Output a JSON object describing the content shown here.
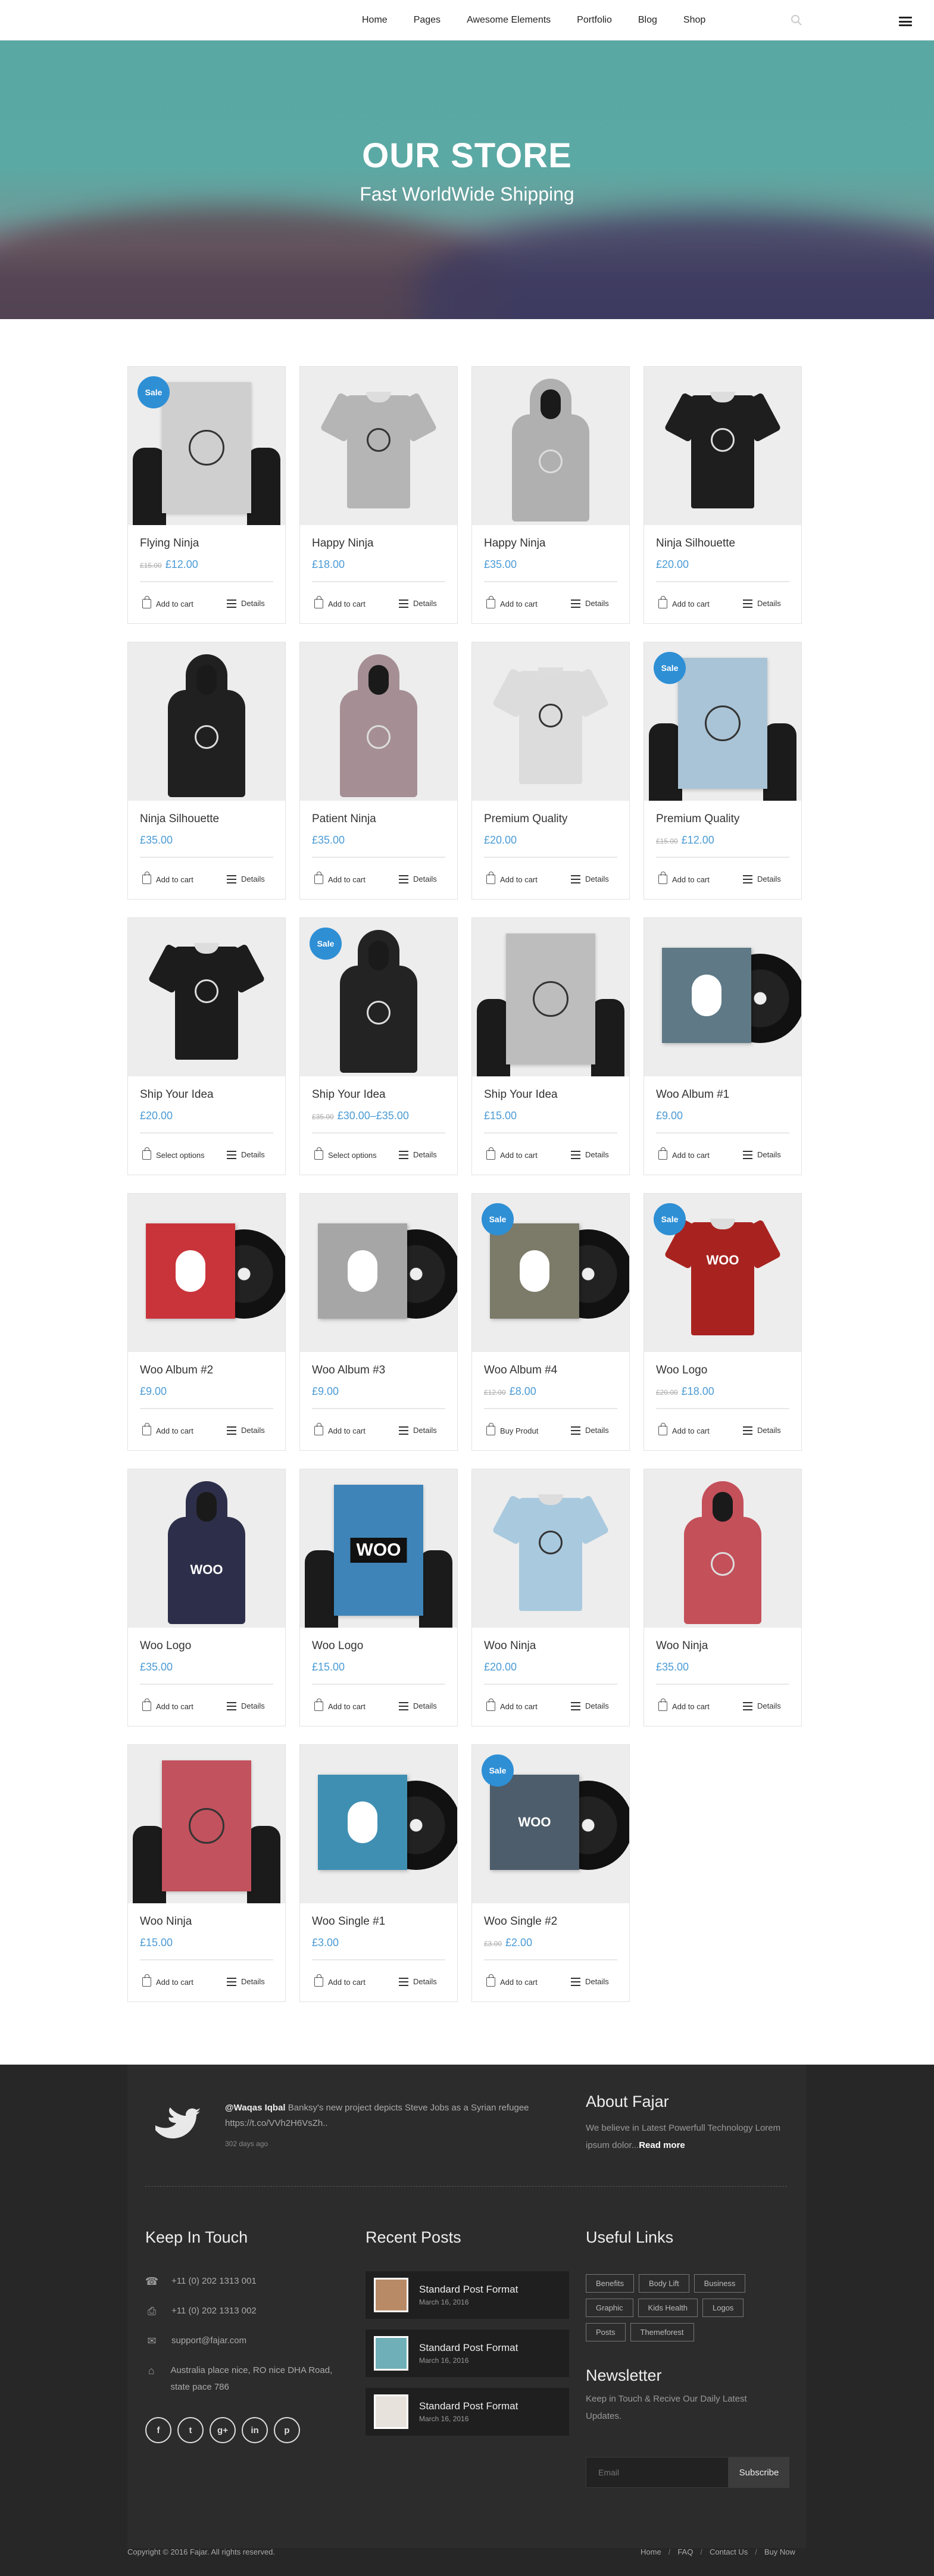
{
  "nav": {
    "items": [
      "Home",
      "Pages",
      "Awesome Elements",
      "Portfolio",
      "Blog",
      "Shop"
    ]
  },
  "hero": {
    "title": "OUR STORE",
    "subtitle": "Fast WorldWide Shipping"
  },
  "products": [
    {
      "title": "Flying Ninja",
      "old_price": "£15.00",
      "price": "£12.00",
      "sale": true,
      "cart_label": "Add to cart",
      "details_label": "Details",
      "art": "poster",
      "color": "#cfcfcf"
    },
    {
      "title": "Happy Ninja",
      "old_price": "",
      "price": "£18.00",
      "sale": false,
      "cart_label": "Add to cart",
      "details_label": "Details",
      "art": "shirt",
      "color": "#b5b5b5"
    },
    {
      "title": "Happy Ninja",
      "old_price": "",
      "price": "£35.00",
      "sale": false,
      "cart_label": "Add to cart",
      "details_label": "Details",
      "art": "hoodie",
      "color": "#b0b0b0"
    },
    {
      "title": "Ninja Silhouette",
      "old_price": "",
      "price": "£20.00",
      "sale": false,
      "cart_label": "Add to cart",
      "details_label": "Details",
      "art": "shirt",
      "color": "#1e1e1e"
    },
    {
      "title": "Ninja Silhouette",
      "old_price": "",
      "price": "£35.00",
      "sale": false,
      "cart_label": "Add to cart",
      "details_label": "Details",
      "art": "hoodie",
      "color": "#202020"
    },
    {
      "title": "Patient Ninja",
      "old_price": "",
      "price": "£35.00",
      "sale": false,
      "cart_label": "Add to cart",
      "details_label": "Details",
      "art": "hoodie",
      "color": "#a58f95"
    },
    {
      "title": "Premium Quality",
      "old_price": "",
      "price": "£20.00",
      "sale": false,
      "cart_label": "Add to cart",
      "details_label": "Details",
      "art": "shirt",
      "color": "#dcdcdc"
    },
    {
      "title": "Premium Quality",
      "old_price": "£15.00",
      "price": "£12.00",
      "sale": true,
      "cart_label": "Add to cart",
      "details_label": "Details",
      "art": "poster",
      "color": "#a9c4d6"
    },
    {
      "title": "Ship Your Idea",
      "old_price": "",
      "price": "£20.00",
      "sale": false,
      "cart_label": "Select options",
      "details_label": "Details",
      "art": "shirt",
      "color": "#1c1c1c"
    },
    {
      "title": "Ship Your Idea",
      "old_price": "£35.00",
      "price": "£30.00–£35.00",
      "sale": true,
      "cart_label": "Select options",
      "details_label": "Details",
      "art": "hoodie",
      "color": "#232323"
    },
    {
      "title": "Ship Your Idea",
      "old_price": "",
      "price": "£15.00",
      "sale": false,
      "cart_label": "Add to cart",
      "details_label": "Details",
      "art": "poster",
      "color": "#bdbdbd"
    },
    {
      "title": "Woo Album #1",
      "old_price": "",
      "price": "£9.00",
      "sale": false,
      "cart_label": "Add to cart",
      "details_label": "Details",
      "art": "album",
      "color": "#5f7a86"
    },
    {
      "title": "Woo Album #2",
      "old_price": "",
      "price": "£9.00",
      "sale": false,
      "cart_label": "Add to cart",
      "details_label": "Details",
      "art": "album",
      "color": "#c9343a"
    },
    {
      "title": "Woo Album #3",
      "old_price": "",
      "price": "£9.00",
      "sale": false,
      "cart_label": "Add to cart",
      "details_label": "Details",
      "art": "album",
      "color": "#a6a6a6"
    },
    {
      "title": "Woo Album #4",
      "old_price": "£12.00",
      "price": "£8.00",
      "sale": true,
      "cart_label": "Buy Produt",
      "details_label": "Details",
      "art": "album",
      "color": "#7c7a68"
    },
    {
      "title": "Woo Logo",
      "old_price": "£20.00",
      "price": "£18.00",
      "sale": true,
      "cart_label": "Add to cart",
      "details_label": "Details",
      "art": "shirt",
      "color": "#a8231f",
      "label": "WOO"
    },
    {
      "title": "Woo Logo",
      "old_price": "",
      "price": "£35.00",
      "sale": false,
      "cart_label": "Add to cart",
      "details_label": "Details",
      "art": "hoodie",
      "color": "#2d2f4a",
      "label": "WOO"
    },
    {
      "title": "Woo Logo",
      "old_price": "",
      "price": "£15.00",
      "sale": false,
      "cart_label": "Add to cart",
      "details_label": "Details",
      "art": "poster",
      "color": "#3e84b8",
      "label": "WOO"
    },
    {
      "title": "Woo Ninja",
      "old_price": "",
      "price": "£20.00",
      "sale": false,
      "cart_label": "Add to cart",
      "details_label": "Details",
      "art": "shirt",
      "color": "#a9c9de"
    },
    {
      "title": "Woo Ninja",
      "old_price": "",
      "price": "£35.00",
      "sale": false,
      "cart_label": "Add to cart",
      "details_label": "Details",
      "art": "hoodie",
      "color": "#c4505a"
    },
    {
      "title": "Woo Ninja",
      "old_price": "",
      "price": "£15.00",
      "sale": false,
      "cart_label": "Add to cart",
      "details_label": "Details",
      "art": "poster",
      "color": "#c2525d"
    },
    {
      "title": "Woo Single #1",
      "old_price": "",
      "price": "£3.00",
      "sale": false,
      "cart_label": "Add to cart",
      "details_label": "Details",
      "art": "album",
      "color": "#3f8fb3"
    },
    {
      "title": "Woo Single #2",
      "old_price": "£3.00",
      "price": "£2.00",
      "sale": true,
      "cart_label": "Add to cart",
      "details_label": "Details",
      "art": "album",
      "color": "#4d5d6b",
      "label": "WOO"
    }
  ],
  "sale_label": "Sale",
  "footer": {
    "tweet": {
      "handle": "@Waqas Iqbal",
      "text": "Banksy's new project depicts Steve Jobs as a Syrian refugee https://t.co/VVh2H6VsZh..",
      "time": "302 days ago"
    },
    "about": {
      "title": "About Fajar",
      "text": "We believe in Latest Powerfull Technology Lorem ipsum dolor...",
      "read_more": "Read more"
    },
    "contact": {
      "title": "Keep In Touch",
      "phone": "+11 (0) 202 1313 001",
      "fax": "+11 (0) 202 1313 002",
      "email": "support@fajar.com",
      "address": "Australia place nice, RO nice DHA Road, state pace 786"
    },
    "socials": [
      "f",
      "t",
      "g+",
      "in",
      "p"
    ],
    "recent": {
      "title": "Recent Posts",
      "posts": [
        {
          "title": "Standard Post Format",
          "date": "March 16, 2016"
        },
        {
          "title": "Standard Post Format",
          "date": "March 16, 2016"
        },
        {
          "title": "Standard Post Format",
          "date": "March 16, 2016"
        }
      ]
    },
    "links": {
      "title": "Useful Links",
      "tags": [
        "Benefits",
        "Body Lift",
        "Business",
        "Graphic",
        "Kids Health",
        "Logos",
        "Posts",
        "Themeforest"
      ]
    },
    "newsletter": {
      "title": "Newsletter",
      "text": "Keep in Touch & Recive Our Daily Latest Updates.",
      "placeholder": "Email",
      "button": "Subscribe"
    },
    "copyright": "Copyright © 2016 Fajar. All rights reserved.",
    "bottom_links": [
      "Home",
      "FAQ",
      "Contact Us",
      "Buy Now"
    ]
  }
}
